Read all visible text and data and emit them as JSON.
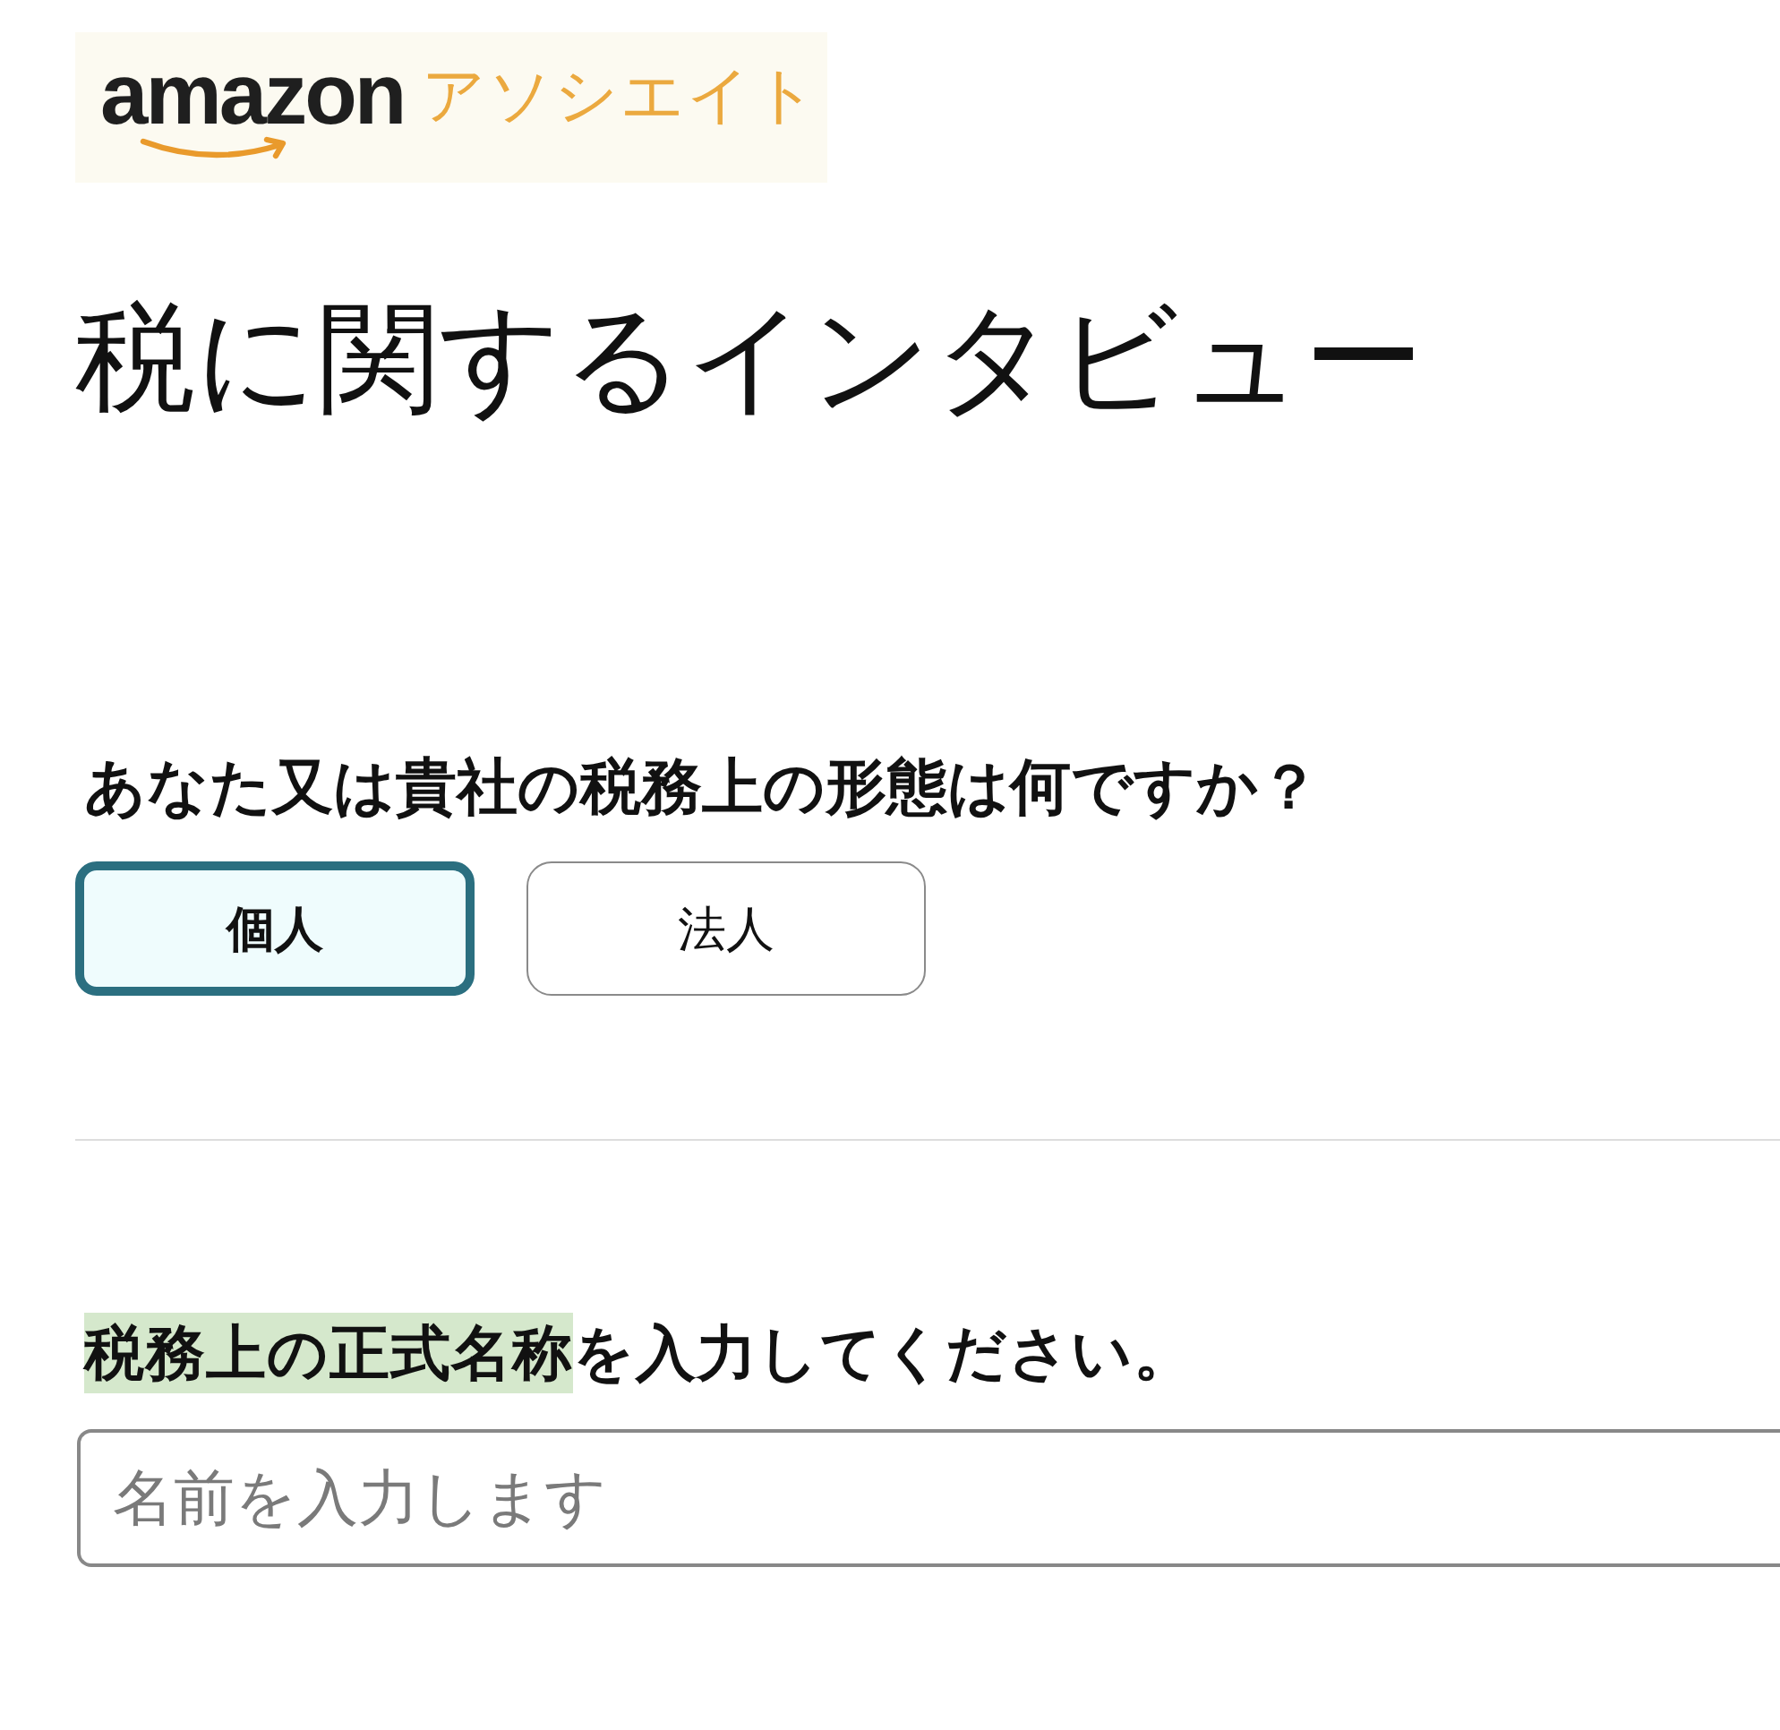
{
  "logo": {
    "wordmark": "amazon",
    "subtitle": "アソシエイト"
  },
  "title": "税に関するインタビュー",
  "entity_question": {
    "label": "あなた又は貴社の税務上の形態は何ですか？",
    "options": [
      {
        "label": "個人",
        "selected": true
      },
      {
        "label": "法人",
        "selected": false
      }
    ]
  },
  "name_field": {
    "label_parts": [
      {
        "text": "税務上の正式名称",
        "highlighted": true
      },
      {
        "text": "を入力してください。",
        "highlighted": false
      }
    ],
    "placeholder": "名前を入力します"
  }
}
